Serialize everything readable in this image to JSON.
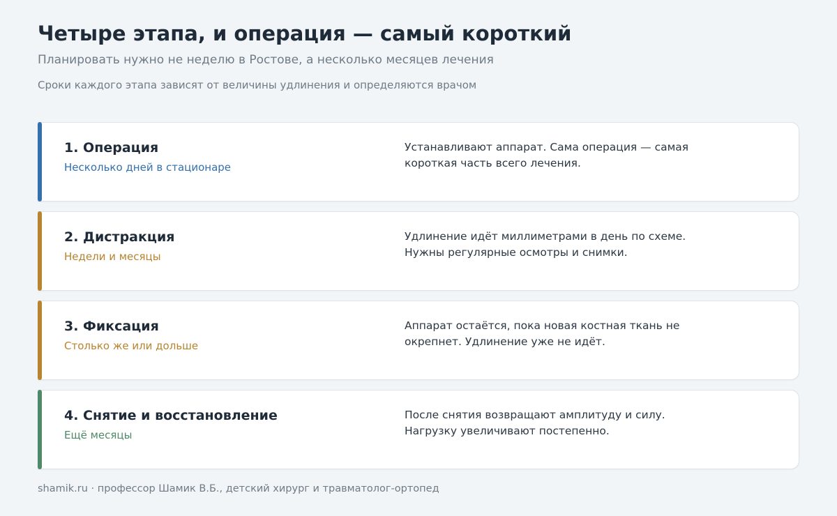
{
  "colors": {
    "background": "#f2f5f8",
    "blue": "#3470ae",
    "gold": "#b8842f",
    "green": "#4e8a69"
  },
  "header": {
    "title": "Четыре этапа, и операция — самый короткий",
    "subtitle": "Планировать нужно не неделю в Ростове, а несколько месяцев лечения",
    "note": "Сроки каждого этапа зависят от величины удлинения и определяются врачом"
  },
  "stages": [
    {
      "title": "1. Операция",
      "duration": "Несколько дней в стационаре",
      "color": "#3470ae",
      "description": [
        "Устанавливают аппарат. Сама операция — самая",
        "короткая часть всего лечения."
      ]
    },
    {
      "title": "2. Дистракция",
      "duration": "Недели и месяцы",
      "color": "#b8842f",
      "description": [
        "Удлинение идёт миллиметрами в день по схеме.",
        "Нужны регулярные осмотры и снимки."
      ]
    },
    {
      "title": "3. Фиксация",
      "duration": "Столько же или дольше",
      "color": "#b8842f",
      "description": [
        "Аппарат остаётся, пока новая костная ткань не",
        "окрепнет. Удлинение уже не идёт."
      ]
    },
    {
      "title": "4. Снятие и восстановление",
      "duration": "Ещё месяцы",
      "color": "#4e8a69",
      "description": [
        "После снятия возвращают амплитуду и силу.",
        "Нагрузку увеличивают постепенно."
      ]
    }
  ],
  "footer": {
    "text": "shamik.ru · профессор Шамик В.Б., детский хирург и травматолог-ортопед"
  }
}
